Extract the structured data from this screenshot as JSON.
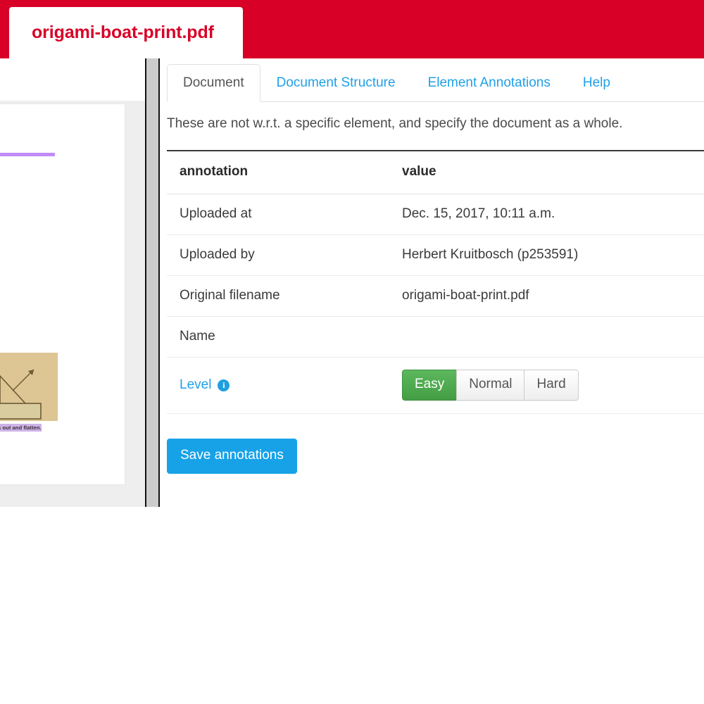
{
  "window": {
    "accent_color": "#d80027",
    "document_tab_label": "origami-boat-print.pdf"
  },
  "left_panel": {
    "pdf_caption_text": "he sides out and flatten."
  },
  "tabs": [
    {
      "label": "Document",
      "active": true
    },
    {
      "label": "Document Structure",
      "active": false
    },
    {
      "label": "Element Annotations",
      "active": false
    },
    {
      "label": "Help",
      "active": false
    }
  ],
  "main": {
    "intro_note": "These are not w.r.t. a specific element, and specify the document as a whole.",
    "table": {
      "headers": [
        "annotation",
        "value"
      ],
      "rows": [
        {
          "annotation": "Uploaded at",
          "value": "Dec. 15, 2017, 10:11 a.m."
        },
        {
          "annotation": "Uploaded by",
          "value": "Herbert Kruitbosch (p253591)"
        },
        {
          "annotation": "Original filename",
          "value": "origami-boat-print.pdf"
        },
        {
          "annotation": "Name",
          "value": ""
        }
      ],
      "level_row": {
        "label": "Level",
        "info_icon_glyph": "i",
        "options": [
          "Easy",
          "Normal",
          "Hard"
        ],
        "selected": "Easy",
        "active_color": "#5cb85c"
      }
    },
    "save_button_label": "Save annotations"
  }
}
